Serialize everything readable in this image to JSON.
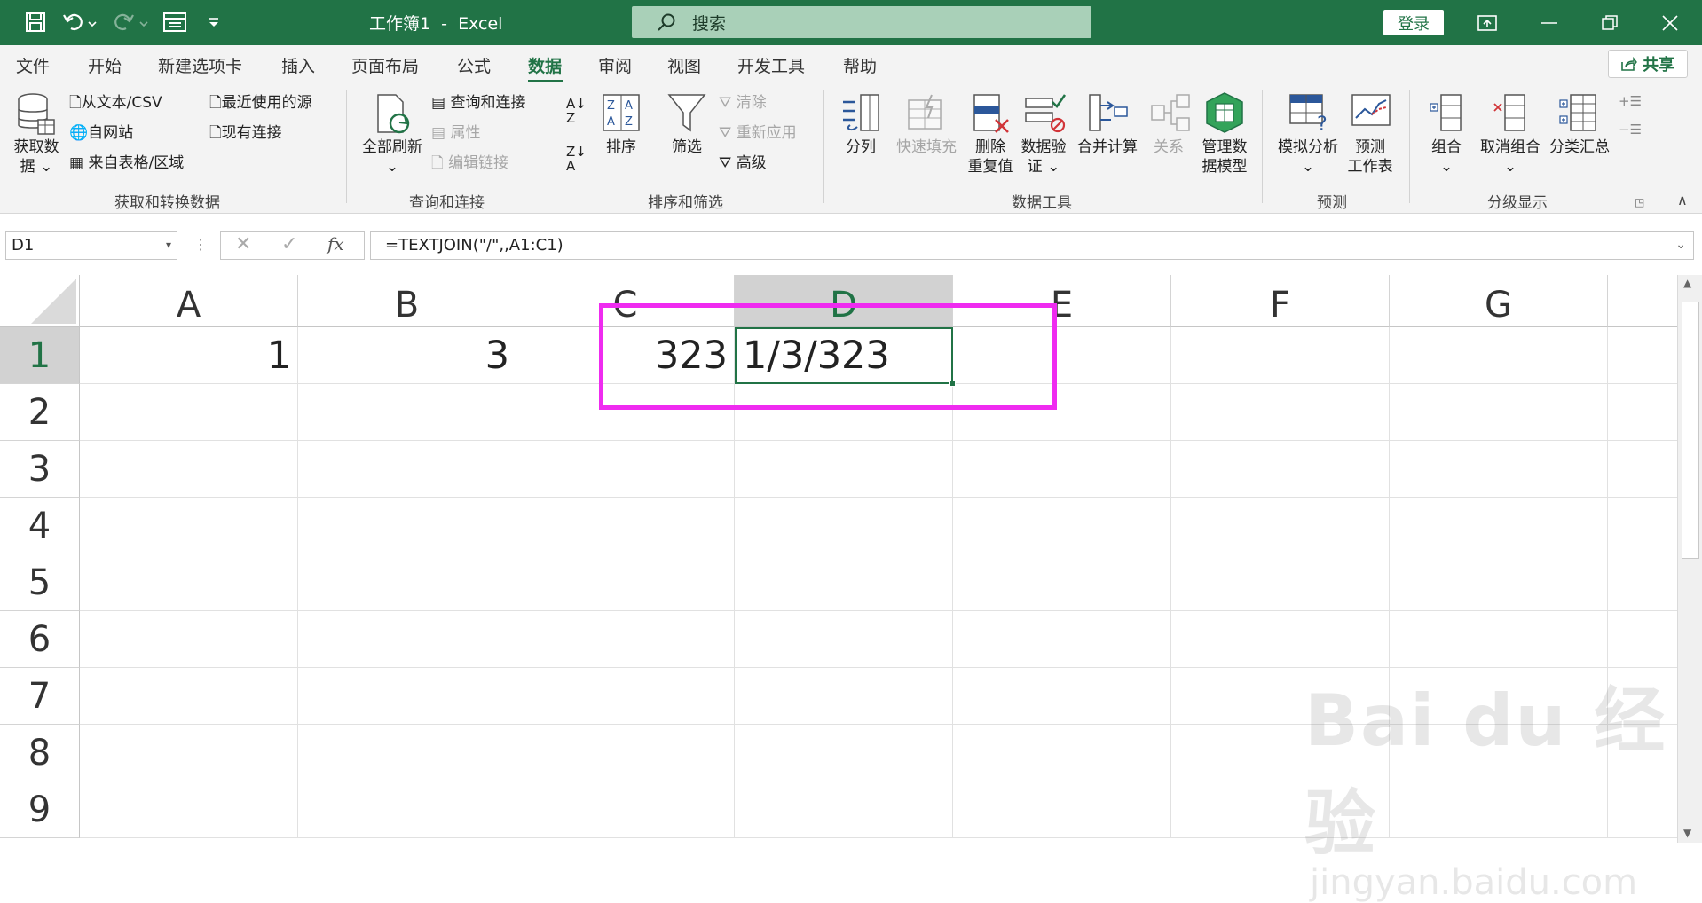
{
  "titlebar": {
    "title": "工作簿1  -  Excel",
    "search_placeholder": "搜索",
    "login_label": "登录"
  },
  "tabs": [
    "文件",
    "开始",
    "新建选项卡",
    "插入",
    "页面布局",
    "公式",
    "数据",
    "审阅",
    "视图",
    "开发工具",
    "帮助"
  ],
  "share_label": "共享",
  "ribbon": {
    "get_data": "获取数",
    "get_data2": "据",
    "from_text": "从文本/CSV",
    "from_web": "自网站",
    "from_table": "来自表格/区域",
    "recent_sources": "最近使用的源",
    "existing_conn": "现有连接",
    "group1": "获取和转换数据",
    "refresh_all": "全部刷新",
    "queries_conn": "查询和连接",
    "properties": "属性",
    "edit_links": "编辑链接",
    "group2": "查询和连接",
    "sort": "排序",
    "filter": "筛选",
    "clear": "清除",
    "reapply": "重新应用",
    "advanced": "高级",
    "group3": "排序和筛选",
    "text_to_cols": "分列",
    "flash_fill": "快速填充",
    "remove_dup1": "删除",
    "remove_dup2": "重复值",
    "validation1": "数据验",
    "validation2": "证",
    "consolidate": "合并计算",
    "relationships": "关系",
    "manage_model1": "管理数",
    "manage_model2": "据模型",
    "group4": "数据工具",
    "what_if": "模拟分析",
    "forecast1": "预测",
    "forecast2": "工作表",
    "group5": "预测",
    "group": "组合",
    "ungroup": "取消组合",
    "subtotal": "分类汇总",
    "group6": "分级显示"
  },
  "formula_bar": {
    "name_box": "D1",
    "formula": "=TEXTJOIN(\"/\",,A1:C1)"
  },
  "columns": [
    "A",
    "B",
    "C",
    "D",
    "E",
    "F",
    "G"
  ],
  "rows": [
    "1",
    "2",
    "3",
    "4",
    "5",
    "6",
    "7",
    "8",
    "9"
  ],
  "cells": {
    "A1": "1",
    "B1": "3",
    "C1": "323",
    "D1": "1/3/323"
  },
  "watermark": {
    "brand": "Bai du 经验",
    "url": "jingyan.baidu.com"
  },
  "colors": {
    "excel_green": "#217346",
    "highlight": "#ef2bf0"
  }
}
